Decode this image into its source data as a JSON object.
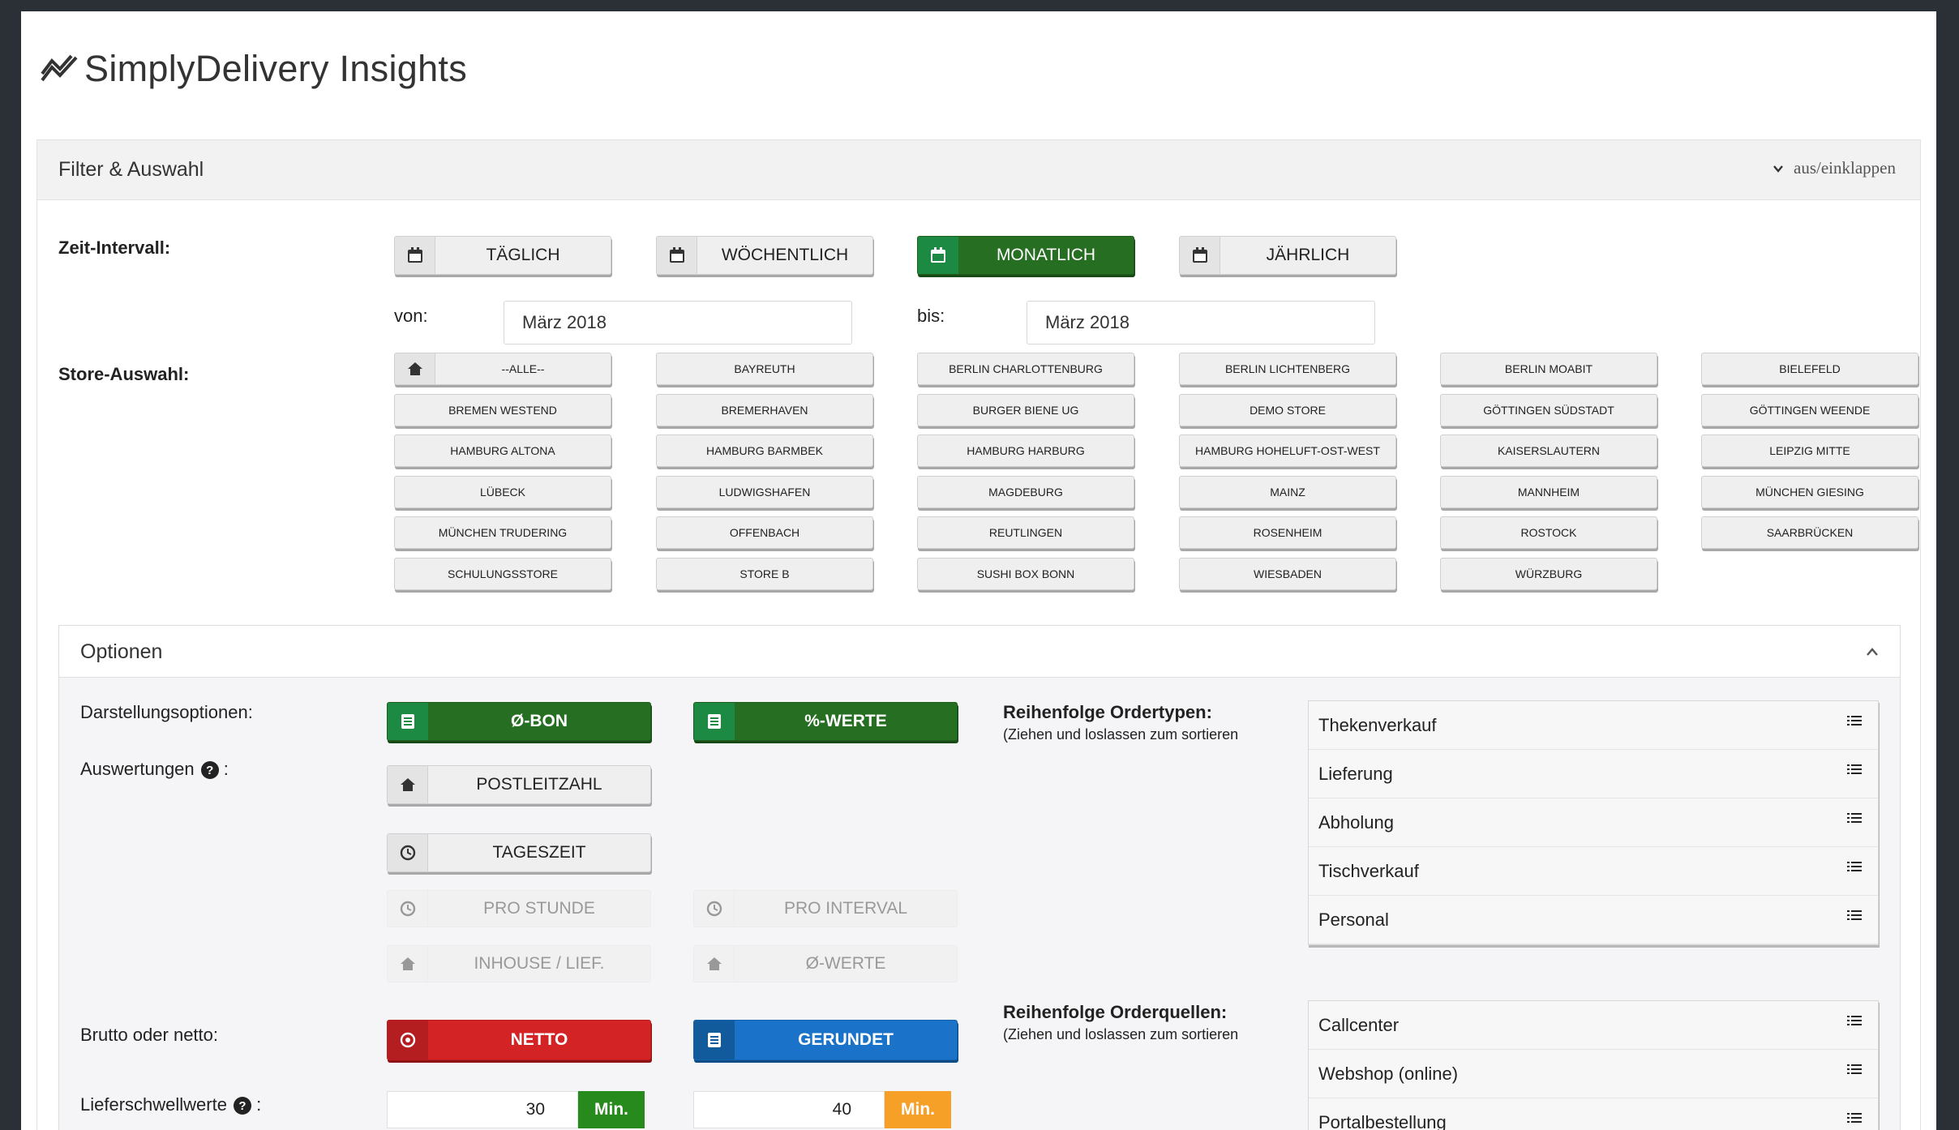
{
  "header": {
    "title": "SimplyDelivery Insights",
    "logo_icon": "trend-line-icon"
  },
  "filter": {
    "title": "Filter & Auswahl",
    "toggle_label": "aus/einklappen",
    "zeit_label": "Zeit-Intervall:",
    "interval_buttons": [
      {
        "label": "TÄGLICH",
        "active": false
      },
      {
        "label": "WÖCHENTLICH",
        "active": false
      },
      {
        "label": "MONATLICH",
        "active": true
      },
      {
        "label": "JÄHRLICH",
        "active": false
      }
    ],
    "von_label": "von:",
    "von_value": "März 2018",
    "bis_label": "bis:",
    "bis_value": "März 2018",
    "store_label": "Store-Auswahl:",
    "stores": [
      "--ALLE--",
      "BAYREUTH",
      "BERLIN CHARLOTTENBURG",
      "BERLIN LICHTENBERG",
      "BERLIN MOABIT",
      "BIELEFELD",
      "BREMEN WESTEND",
      "BREMERHAVEN",
      "BURGER BIENE UG",
      "DEMO STORE",
      "GÖTTINGEN SÜDSTADT",
      "GÖTTINGEN WEENDE",
      "HAMBURG ALTONA",
      "HAMBURG BARMBEK",
      "HAMBURG HARBURG",
      "HAMBURG HOHELUFT-OST-WEST",
      "KAISERSLAUTERN",
      "LEIPZIG MITTE",
      "LÜBECK",
      "LUDWIGSHAFEN",
      "MAGDEBURG",
      "MAINZ",
      "MANNHEIM",
      "MÜNCHEN GIESING",
      "MÜNCHEN TRUDERING",
      "OFFENBACH",
      "REUTLINGEN",
      "ROSENHEIM",
      "ROSTOCK",
      "SAARBRÜCKEN",
      "SCHULUNGSSTORE",
      "STORE B",
      "SUSHI BOX BONN",
      "WIESBADEN",
      "WÜRZBURG"
    ]
  },
  "options": {
    "title": "Optionen",
    "darstellung_label": "Darstellungsoptionen:",
    "darstellung_buttons": [
      "Ø-BON",
      "%-WERTE"
    ],
    "auswertungen_label": "Auswertungen",
    "auswertungen_suffix": ":",
    "auswertung_buttons": {
      "postleitzahl": "POSTLEITZAHL",
      "tageszeit": "TAGESZEIT",
      "pro_stunde": "PRO STUNDE",
      "pro_interval": "PRO INTERVAL",
      "inhouse": "INHOUSE / LIEF.",
      "werte": "Ø-WERTE"
    },
    "brutto_label": "Brutto oder netto:",
    "netto_label": "NETTO",
    "gerundet_label": "GERUNDET",
    "liefer_label": "Lieferschwellwerte",
    "liefer_suffix": ":",
    "liefer_values": [
      "30",
      "40"
    ],
    "min_label": "Min.",
    "ordertypen_label": "Reihenfolge Ordertypen:",
    "ordertypen_note": "(Ziehen und loslassen zum sortieren",
    "ordertypen": [
      "Thekenverkauf",
      "Lieferung",
      "Abholung",
      "Tischverkauf",
      "Personal"
    ],
    "orderquellen_label": "Reihenfolge Orderquellen:",
    "orderquellen_note": "(Ziehen und loslassen zum sortieren",
    "orderquellen": [
      "Callcenter",
      "Webshop (online)",
      "Portalbestellung"
    ]
  },
  "colors": {
    "green": "#266f22",
    "red": "#d42325",
    "blue": "#1a73c9",
    "orange": "#f7a028"
  }
}
